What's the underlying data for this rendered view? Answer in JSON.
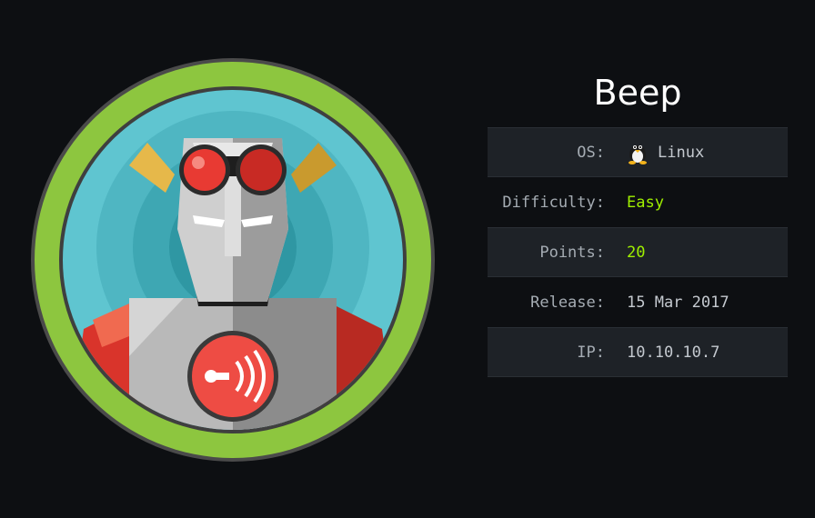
{
  "machine": {
    "name": "Beep",
    "info": [
      {
        "label": "OS:",
        "value": "Linux",
        "icon": "tux-icon",
        "accent": false,
        "shaded": true
      },
      {
        "label": "Difficulty:",
        "value": "Easy",
        "accent": true,
        "shaded": false
      },
      {
        "label": "Points:",
        "value": "20",
        "accent": true,
        "shaded": true
      },
      {
        "label": "Release:",
        "value": "15 Mar 2017",
        "accent": false,
        "shaded": false
      },
      {
        "label": "IP:",
        "value": "10.10.10.7",
        "accent": false,
        "shaded": true
      }
    ]
  },
  "colors": {
    "background": "#0d0f12",
    "ring": "#8dc63f",
    "accent": "#9fef00",
    "row_shade": "#1e2227"
  },
  "avatar": {
    "icon": "robot-avatar-icon"
  }
}
